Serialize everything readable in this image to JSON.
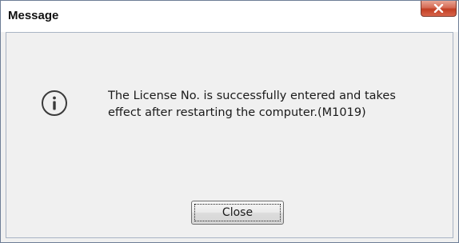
{
  "window": {
    "title": "Message"
  },
  "message": {
    "line1": "The License No. is successfully entered and takes",
    "line2": "effect after restarting the computer.(M1019)"
  },
  "buttons": {
    "close_label": "Close"
  },
  "icons": {
    "info": "info-icon",
    "title_close": "close-icon"
  },
  "colors": {
    "title_close_red": "#c13e23",
    "background": "#f0f0f0"
  }
}
